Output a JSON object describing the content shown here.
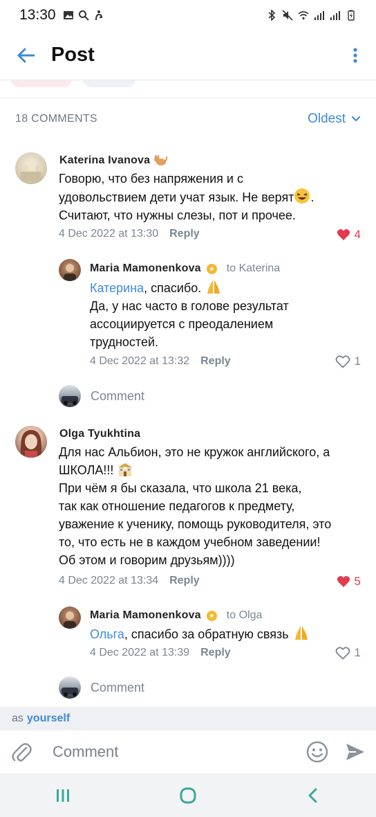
{
  "status": {
    "time": "13:30"
  },
  "header": {
    "title": "Post"
  },
  "comments_header": {
    "count_label": "18 COMMENTS",
    "sort_label": "Oldest"
  },
  "comments": [
    {
      "author": "Katerina Ivanova",
      "text_lines": [
        "Говорю, что без напряжения и с",
        "удовольствием дети учат язык. Не верят",
        "Считают, что нужны слезы, пот и прочее."
      ],
      "date": "4 Dec 2022 at 13:30",
      "reply_label": "Reply",
      "likes": "4"
    },
    {
      "author": "Maria Mamonenkova",
      "to": "to Katerina",
      "mention": "Катерина",
      "text_after_mention": ", спасибо.",
      "text_lines": [
        "Да, у нас часто в голове результат",
        "ассоциируется с преодалением",
        "трудностей."
      ],
      "date": "4 Dec 2022 at 13:32",
      "reply_label": "Reply",
      "likes": "1"
    },
    {
      "author": "Olga Tyukhtina",
      "text_lines": [
        "Для нас Альбион, это не кружок английского, а",
        "ШКОЛА!!!",
        "При чём я бы сказала, что школа 21 века,",
        "так как отношение педагогов к предмету,",
        "уважение к ученику, помощь руководителя, это",
        "то, что есть не в каждом учебном заведении!",
        "Об этом и говорим друзьям))))"
      ],
      "date": "4 Dec 2022 at 13:34",
      "reply_label": "Reply",
      "likes": "5"
    },
    {
      "author": "Maria Mamonenkova",
      "to": "to Olga",
      "mention": "Ольга",
      "text_after_mention": ", спасибо за обратную связь",
      "date": "4 Dec 2022 at 13:39",
      "reply_label": "Reply",
      "likes": "1"
    }
  ],
  "comment_prompt": "Comment",
  "composer": {
    "as_label": "as",
    "as_user": "yourself",
    "placeholder": "Comment"
  },
  "colors": {
    "accent": "#3f8ad8",
    "like_red": "#e23b4f",
    "muted": "#7b8592"
  }
}
